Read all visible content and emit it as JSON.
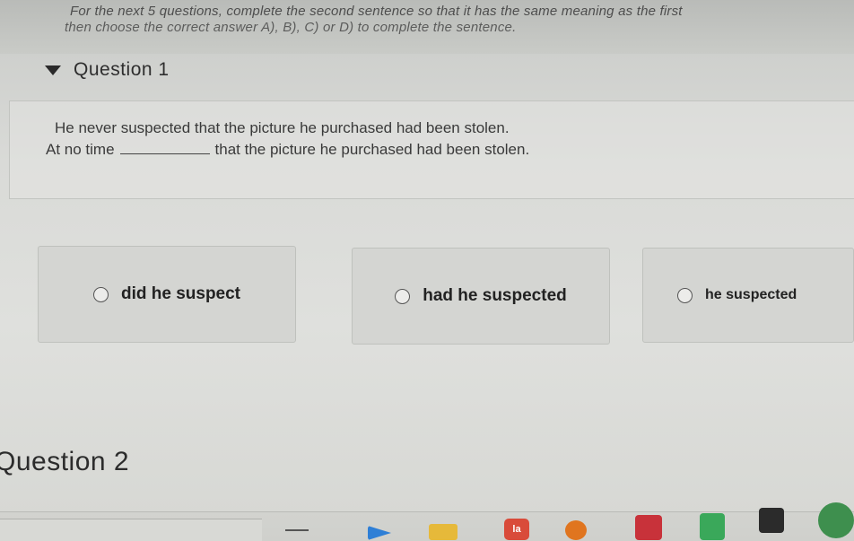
{
  "instructions": {
    "line1": "For the next 5 questions, complete the second sentence so that it has the same meaning as the first",
    "line2": "then choose the correct answer A), B), C) or D) to complete the sentence."
  },
  "question1": {
    "title": "Question 1",
    "sentence1": "He never suspected that the picture he purchased had been stolen.",
    "sentence2_start": "At no time",
    "sentence2_end": "that the picture he purchased had been stolen."
  },
  "choices": [
    {
      "label": "did he suspect"
    },
    {
      "label": "had he suspected"
    },
    {
      "label": "he suspected"
    }
  ],
  "question2": {
    "title": "Question 2"
  },
  "taskbar": {
    "icons": [
      {
        "name": "file-explorer-icon",
        "color": "#e6b93a"
      },
      {
        "name": "blue-app-icon",
        "color": "#2e7fd6"
      },
      {
        "name": "taz-app-icon",
        "color": "#d94b3a",
        "text": "la"
      },
      {
        "name": "orange-app-icon",
        "color": "#e0751f"
      },
      {
        "name": "red-app-icon",
        "color": "#c8323a"
      },
      {
        "name": "green-app-icon",
        "color": "#3aa85a"
      },
      {
        "name": "dark-app-icon",
        "color": "#2b2b2b"
      },
      {
        "name": "chrome-icon",
        "color": "#3e8f4e"
      }
    ]
  }
}
